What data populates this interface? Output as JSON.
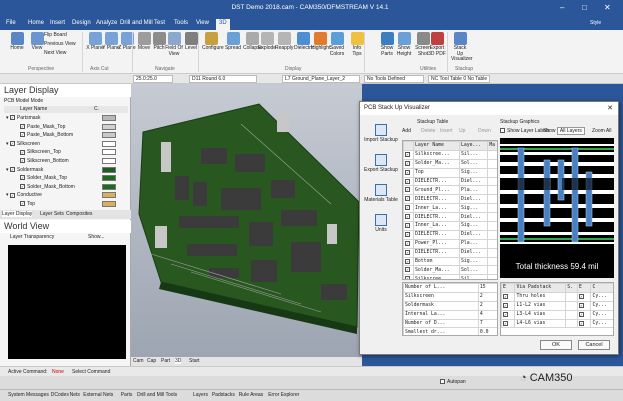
{
  "window": {
    "title": "DST Demo 2018.cam - CAM350/DFMSTREAM V 14.1",
    "style_label": "Style"
  },
  "menu": [
    "File",
    "Home",
    "Insert",
    "Design",
    "Analyze",
    "Drill and Mill",
    "Test",
    "Tools",
    "View",
    "3D"
  ],
  "ribbon": {
    "buttons": [
      {
        "label": "Home",
        "name": "home-view-button"
      },
      {
        "label": "View",
        "name": "view-button"
      },
      {
        "label": "X Plane",
        "name": "x-plane-button"
      },
      {
        "label": "Y Plane",
        "name": "y-plane-button"
      },
      {
        "label": "Z Plane",
        "name": "z-plane-button"
      },
      {
        "label": "Move",
        "name": "move-button"
      },
      {
        "label": "Pitch",
        "name": "pitch-button"
      },
      {
        "label": "Field Of View",
        "name": "field-of-view-button"
      },
      {
        "label": "Level",
        "name": "level-button"
      },
      {
        "label": "Configure",
        "name": "configure-button"
      },
      {
        "label": "Spread",
        "name": "spread-button"
      },
      {
        "label": "Collapse",
        "name": "collapse-button"
      },
      {
        "label": "Explode",
        "name": "explode-button"
      },
      {
        "label": "Reapply",
        "name": "reapply-button"
      },
      {
        "label": "Dielectric",
        "name": "dielectric-button"
      },
      {
        "label": "Highlight",
        "name": "highlight-button"
      },
      {
        "label": "Saved Colors",
        "name": "saved-colors-button"
      },
      {
        "label": "Info Tips",
        "name": "info-tips-button"
      },
      {
        "label": "Show Parts",
        "name": "show-parts-button"
      },
      {
        "label": "Show Height",
        "name": "show-height-button"
      },
      {
        "label": "Screen Shot",
        "name": "screen-shot-button"
      },
      {
        "label": "Export 3D PDF",
        "name": "export-3d-pdf-button"
      },
      {
        "label": "Stack Up Visualizer",
        "name": "stack-up-visualizer-button"
      }
    ],
    "small": [
      "Flip Board",
      "Previous View",
      "Next View"
    ],
    "groups": [
      "Perspective",
      "Axis Cut",
      "Navigate",
      "Display",
      "Utilities",
      "Stackup"
    ]
  },
  "optbar": {
    "grid": "25.0:25.0",
    "dcode": "D11  Round 6.0",
    "layer": "L7 Ground_Plane_Layer_2",
    "tools": "No Tools Defined",
    "nctool": "NC Tool Table  0 No Table"
  },
  "layer_display": {
    "title": "Layer Display",
    "mode_label": "PCB Model Mode",
    "header": {
      "name": "Layer Name",
      "c": "C."
    },
    "rows": [
      {
        "label": "Partsmask",
        "indent": 0,
        "group": true,
        "color": "#b9b9b9"
      },
      {
        "label": "Paste_Mask_Top",
        "indent": 1,
        "group": false,
        "color": "#d0d0d0"
      },
      {
        "label": "Paste_Mask_Bottom",
        "indent": 1,
        "group": false,
        "color": "#c9c9c9"
      },
      {
        "label": "Silkscreen",
        "indent": 0,
        "group": true,
        "color": "#ffffff"
      },
      {
        "label": "Silkscreen_Top",
        "indent": 1,
        "group": false,
        "color": "#ffffff"
      },
      {
        "label": "Silkscreen_Bottom",
        "indent": 1,
        "group": false,
        "color": "#ffffff"
      },
      {
        "label": "Soldermask",
        "indent": 0,
        "group": true,
        "color": "#1e5e1e"
      },
      {
        "label": "Solder_Mask_Top",
        "indent": 1,
        "group": false,
        "color": "#1e6b1e"
      },
      {
        "label": "Solder_Mask_Bottom",
        "indent": 1,
        "group": false,
        "color": "#1e6b1e"
      },
      {
        "label": "Conductive",
        "indent": 0,
        "group": true,
        "color": "#d8b060"
      },
      {
        "label": "Top",
        "indent": 1,
        "group": false,
        "color": "#d8b060"
      }
    ],
    "tabs": [
      "Layer Display",
      "Layer Sets",
      "Composites"
    ]
  },
  "world_view": {
    "title": "World View",
    "transparency_label": "Layer Transparency",
    "show_label": "Show..."
  },
  "canvas_tabs": [
    "Cam",
    "Cap",
    "Part",
    "3D",
    "Start"
  ],
  "command": {
    "label": "Active Command:",
    "value": "None",
    "select": "Select Command"
  },
  "status": {
    "autopan": "Autopan"
  },
  "bottom_tabs": [
    "System Messages",
    "DCodes",
    "Nets",
    "External Nets",
    "Parts",
    "Drill and Mill Tools",
    "Layers",
    "Padstacks",
    "Rule Areas",
    "Error Explorer"
  ],
  "dialog": {
    "title": "PCB Stack Up Visualizer",
    "side": [
      "Import Stackup",
      "Export Stackup",
      "Materials Table",
      "Units"
    ],
    "table_title": "Stackup Table",
    "graphics_title": "Stackup Graphics",
    "toolbar": [
      "Add",
      "Delete",
      "Insert",
      "Up",
      "Down"
    ],
    "show_labels": "Show Layer Labels",
    "show": "Show",
    "show_value": "All Layers",
    "zoom": "Zoom All",
    "columns": [
      "",
      "Layer Name",
      "Laye...",
      "Ma"
    ],
    "rows": [
      {
        "name": "Silkscree...",
        "type": "Sil..."
      },
      {
        "name": "Solder_Ma...",
        "type": "Sol..."
      },
      {
        "name": "Top",
        "type": "Sig..."
      },
      {
        "name": "DIELECTR...",
        "type": "Diel..."
      },
      {
        "name": "Ground_Pl...",
        "type": "Pla..."
      },
      {
        "name": "DIELECTR...",
        "type": "Diel..."
      },
      {
        "name": "Inner_La...",
        "type": "Sig..."
      },
      {
        "name": "DIELECTR...",
        "type": "Diel..."
      },
      {
        "name": "Inner_La...",
        "type": "Sig..."
      },
      {
        "name": "DIELECTR...",
        "type": "Diel..."
      },
      {
        "name": "Power_Pl...",
        "type": "Pla..."
      },
      {
        "name": "DIELECTR...",
        "type": "Diel..."
      },
      {
        "name": "Bottom",
        "type": "Sig..."
      },
      {
        "name": "Solder_Ma...",
        "type": "Sol..."
      },
      {
        "name": "Silkscree...",
        "type": "Sil..."
      }
    ],
    "summary": [
      {
        "label": "Number of L...",
        "value": "15"
      },
      {
        "label": "Silkscreen",
        "value": "2"
      },
      {
        "label": "Soldermask",
        "value": "2"
      },
      {
        "label": "Internal La...",
        "value": "4"
      },
      {
        "label": "Number of D...",
        "value": "7"
      },
      {
        "label": "Smallest dr...",
        "value": "0.0"
      }
    ],
    "total_thickness": "Total thickness 59.4 mil",
    "via_header": [
      "E",
      "Via Padstack",
      "S.",
      "E",
      "C"
    ],
    "vias": [
      {
        "name": "Thru holes",
        "e": "Cy..."
      },
      {
        "name": "L1-L2 vias",
        "e": "Cy..."
      },
      {
        "name": "L3-L4 vias",
        "e": "Cy..."
      },
      {
        "name": "L4-L6 vias",
        "e": "Cy..."
      }
    ],
    "ok": "OK",
    "cancel": "Cancel"
  },
  "watermark": "CAM350"
}
